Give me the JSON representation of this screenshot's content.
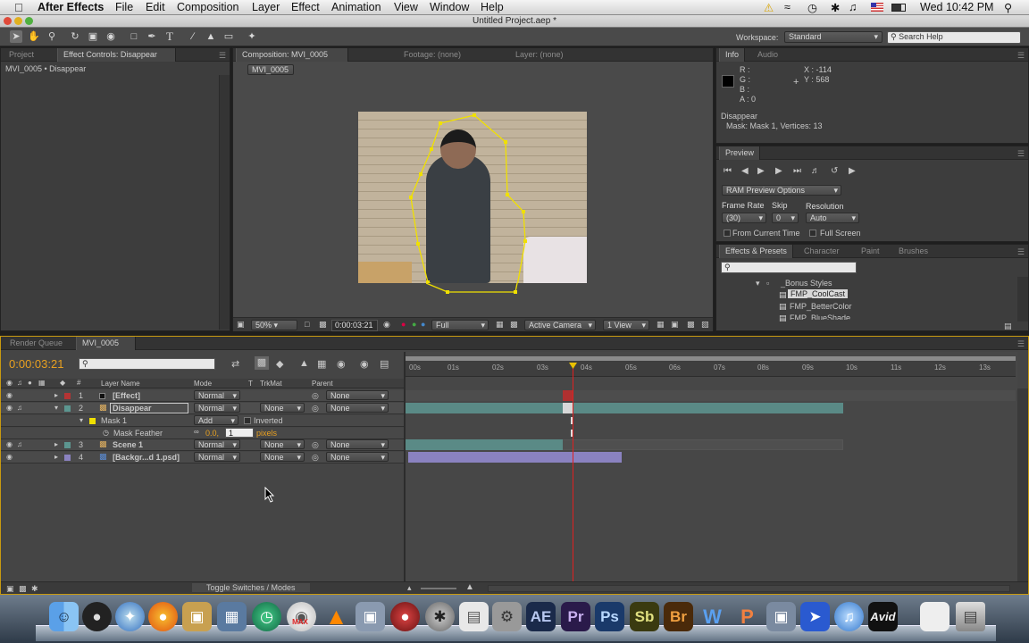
{
  "menubar": {
    "app": "After Effects",
    "menus": [
      "File",
      "Edit",
      "Composition",
      "Layer",
      "Effect",
      "Animation",
      "View",
      "Window",
      "Help"
    ],
    "clock": "Wed 10:42 PM"
  },
  "window": {
    "title": "Untitled Project.aep *"
  },
  "toolbar": {
    "workspace_label": "Workspace:",
    "workspace_value": "Standard",
    "search_placeholder": "Search Help"
  },
  "left_panel": {
    "tab_project": "Project",
    "tab_effect_controls": "Effect Controls: Disappear",
    "breadcrumb": "MVI_0005 • Disappear"
  },
  "comp_panel": {
    "tab_comp": "Composition: MVI_0005",
    "tab_footage": "Footage: (none)",
    "tab_layer": "Layer: (none)",
    "comp_button": "MVI_0005",
    "zoom": "50%",
    "timecode": "0:00:03:21",
    "resolution": "Full",
    "camera": "Active Camera",
    "view": "1 View"
  },
  "info": {
    "tab_info": "Info",
    "tab_audio": "Audio",
    "r": "R :",
    "g": "G :",
    "b": "B :",
    "a": "A : 0",
    "x": "X : -114",
    "y": "Y : 568",
    "layer": "Disappear",
    "detail": "Mask: Mask 1, Vertices: 13"
  },
  "preview": {
    "tab": "Preview",
    "ram_options": "RAM Preview Options",
    "frame_rate_label": "Frame Rate",
    "skip_label": "Skip",
    "resolution_label": "Resolution",
    "frame_rate": "(30)",
    "skip": "0",
    "resolution": "Auto",
    "from_current": "From Current Time",
    "full_screen": "Full Screen"
  },
  "effects": {
    "tabs": [
      "Effects & Presets",
      "Character",
      "Paint",
      "Brushes"
    ],
    "folder": "_Bonus Styles",
    "items": [
      "FMP_CoolCast",
      "FMP_BetterColor",
      "FMP_BlueShade"
    ]
  },
  "timeline": {
    "tab_render": "Render Queue",
    "tab_comp": "MVI_0005",
    "timecode": "0:00:03:21",
    "col_layer_name": "Layer Name",
    "col_mode": "Mode",
    "col_t": "T",
    "col_trkmat": "TrkMat",
    "col_parent": "Parent",
    "ruler": [
      "00s",
      "01s",
      "02s",
      "03s",
      "04s",
      "05s",
      "06s",
      "07s",
      "08s",
      "09s",
      "10s",
      "11s",
      "12s",
      "13s"
    ],
    "layers": [
      {
        "num": "1",
        "name": "[Effect]",
        "mode": "Normal",
        "trkmat": "",
        "parent": "None"
      },
      {
        "num": "2",
        "name": "Disappear",
        "mode": "Normal",
        "trkmat": "None",
        "parent": "None"
      },
      {
        "num": "3",
        "name": "Scene 1",
        "mode": "Normal",
        "trkmat": "None",
        "parent": "None"
      },
      {
        "num": "4",
        "name": "[Backgr...d 1.psd]",
        "mode": "Normal",
        "trkmat": "None",
        "parent": "None"
      }
    ],
    "mask_name": "Mask 1",
    "mask_mode": "Add",
    "mask_inverted": "Inverted",
    "feather_label": "Mask Feather",
    "feather_value": "0.0,",
    "feather_input": "1",
    "feather_unit": "pixels",
    "toggle_label": "Toggle Switches / Modes"
  },
  "dock": [
    "AE",
    "Pr",
    "Ps",
    "Sb",
    "Br",
    "Avid"
  ],
  "colors": {
    "accent_orange": "#e8a020",
    "mask_yellow": "#f0e000",
    "cti_red": "#e02020",
    "bar_teal": "#5a8a86",
    "bar_lavender": "#8a82c0"
  }
}
